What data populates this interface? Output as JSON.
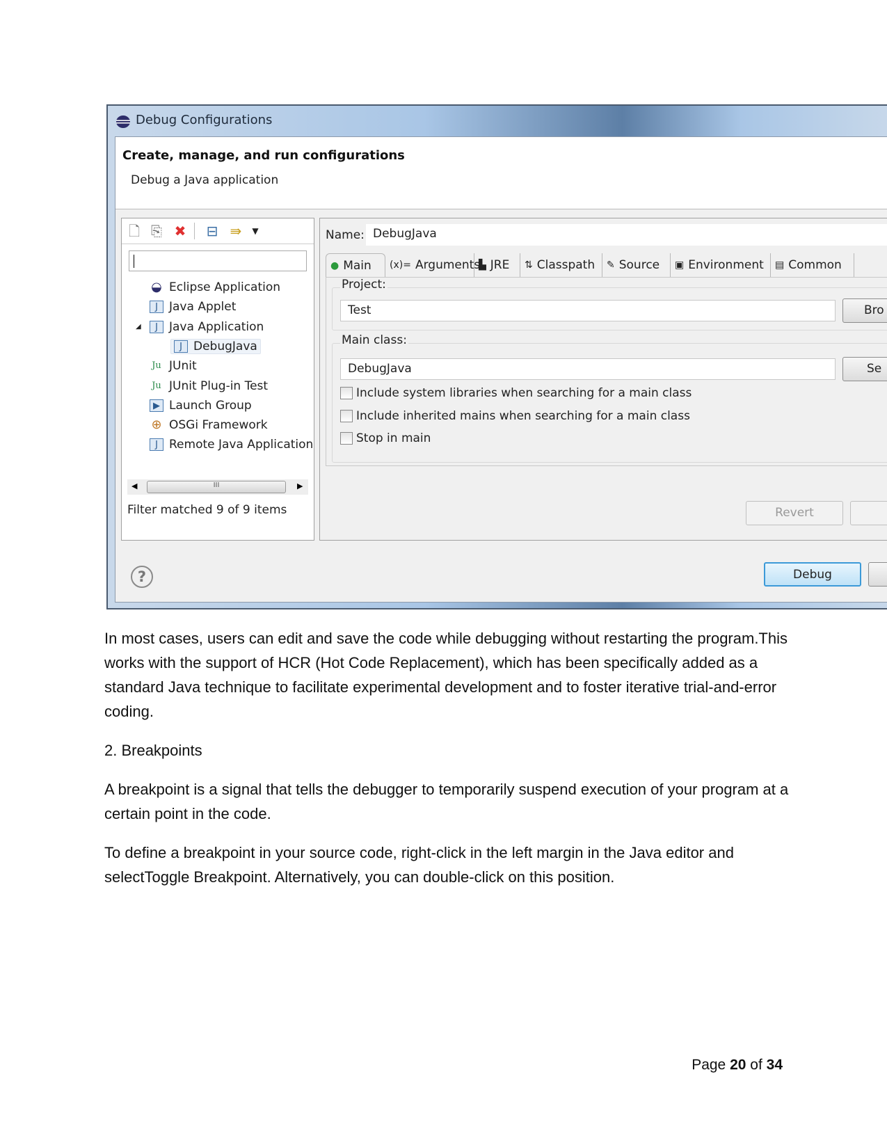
{
  "dialog": {
    "title": "Debug Configurations",
    "header_title": "Create, manage, and run configurations",
    "header_subtitle": "Debug a Java application",
    "toolbar": [
      "new-config-icon",
      "duplicate-icon",
      "delete-icon",
      "collapse-all-icon",
      "filter-icon",
      "dropdown-icon"
    ],
    "filter_value": "",
    "tree": [
      {
        "label": "Eclipse Application",
        "icon": "eclipse-icon"
      },
      {
        "label": "Java Applet",
        "icon": "applet-icon"
      },
      {
        "label": "Java Application",
        "icon": "java-app-icon",
        "expanded": true
      },
      {
        "label": "DebugJava",
        "icon": "java-app-icon",
        "child": true,
        "selected": true
      },
      {
        "label": "JUnit",
        "icon": "junit-icon"
      },
      {
        "label": "JUnit Plug-in Test",
        "icon": "junit-plugin-icon"
      },
      {
        "label": "Launch Group",
        "icon": "launch-group-icon"
      },
      {
        "label": "OSGi Framework",
        "icon": "osgi-icon"
      },
      {
        "label": "Remote Java Application",
        "icon": "remote-java-icon"
      }
    ],
    "filter_status": "Filter matched 9 of 9 items",
    "name_label": "Name:",
    "name_value": "DebugJava",
    "tabs": [
      {
        "label": "Main",
        "icon": "main-icon",
        "active": true
      },
      {
        "label": "Arguments",
        "icon": "(x)="
      },
      {
        "label": "JRE",
        "icon": "jre-icon"
      },
      {
        "label": "Classpath",
        "icon": "classpath-icon"
      },
      {
        "label": "Source",
        "icon": "source-icon"
      },
      {
        "label": "Environment",
        "icon": "environment-icon"
      },
      {
        "label": "Common",
        "icon": "common-icon"
      }
    ],
    "project_label": "Project:",
    "project_value": "Test",
    "browse_label": "Bro",
    "main_class_label": "Main class:",
    "main_class_value": "DebugJava",
    "search_label": "Se",
    "checkboxes": [
      {
        "label": "Include system libraries when searching for a main class",
        "checked": false
      },
      {
        "label": "Include inherited mains when searching for a main class",
        "checked": false
      },
      {
        "label": "Stop in main",
        "checked": false
      }
    ],
    "revert_label": "Revert",
    "debug_label": "Debug",
    "accent": "#3c9ad8"
  },
  "body": {
    "para1": "In most cases, users can edit and save the code while debugging without restarting the program.This works with the support of HCR (Hot Code Replacement), which has been specifically added as a standard Java technique to facilitate experimental development and to foster iterative trial-and-error coding.",
    "heading": "2. Breakpoints",
    "para2": "A breakpoint is a signal that tells the debugger to temporarily suspend execution of your program at a certain point in the code.",
    "para3": "To define a breakpoint in your source code, right-click in the left margin in the Java editor and selectToggle Breakpoint. Alternatively, you can double-click on this position."
  },
  "footer": {
    "page_prefix": "Page",
    "page": "20",
    "of": "of",
    "total": "34"
  }
}
